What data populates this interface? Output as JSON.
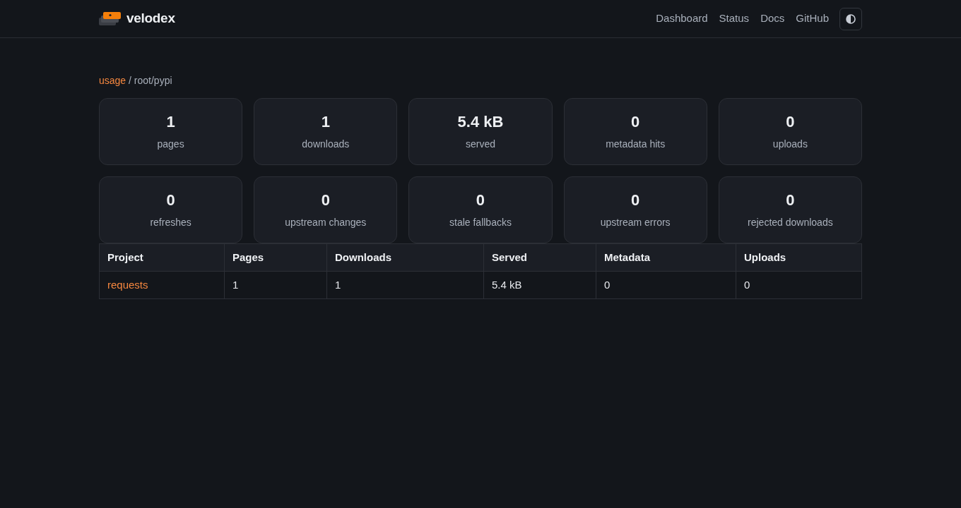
{
  "navbar": {
    "brand": "velodex",
    "links": [
      "Dashboard",
      "Status",
      "Docs",
      "GitHub"
    ]
  },
  "breadcrumb": {
    "link": "usage",
    "path": "/ root/pypi"
  },
  "stats": [
    {
      "value": "1",
      "label": "pages"
    },
    {
      "value": "1",
      "label": "downloads"
    },
    {
      "value": "5.4 kB",
      "label": "served"
    },
    {
      "value": "0",
      "label": "metadata hits"
    },
    {
      "value": "0",
      "label": "uploads"
    },
    {
      "value": "0",
      "label": "refreshes"
    },
    {
      "value": "0",
      "label": "upstream changes"
    },
    {
      "value": "0",
      "label": "stale fallbacks"
    },
    {
      "value": "0",
      "label": "upstream errors"
    },
    {
      "value": "0",
      "label": "rejected downloads"
    }
  ],
  "table": {
    "columns": [
      "Project",
      "Pages",
      "Downloads",
      "Served",
      "Metadata",
      "Uploads"
    ],
    "rows": [
      {
        "cells": [
          {
            "kind": "link",
            "text": "requests"
          },
          {
            "kind": "text",
            "text": "1"
          },
          {
            "kind": "text",
            "text": "1"
          },
          {
            "kind": "text",
            "text": "5.4 kB"
          },
          {
            "kind": "text",
            "text": "0"
          },
          {
            "kind": "text",
            "text": "0"
          }
        ]
      }
    ]
  }
}
